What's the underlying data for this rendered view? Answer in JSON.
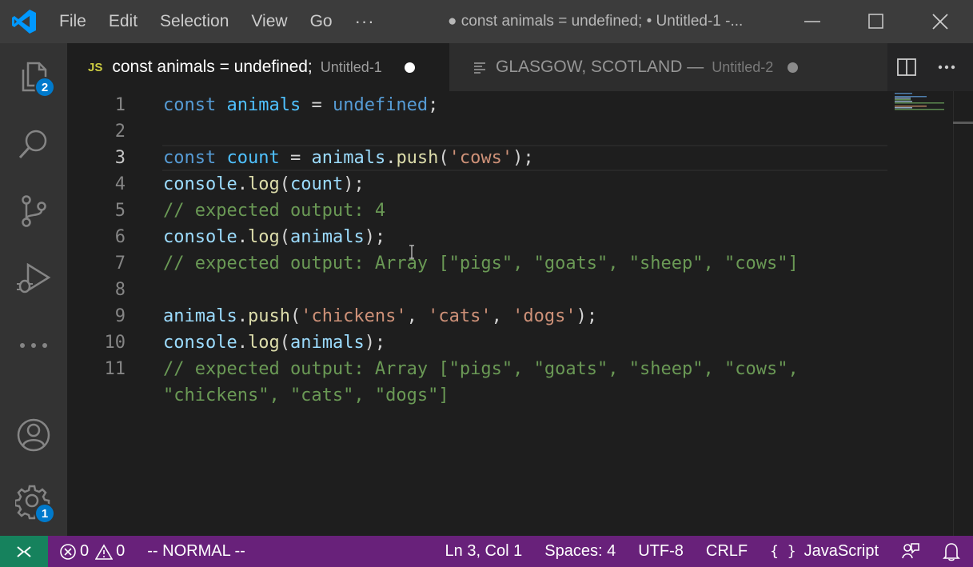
{
  "menu": {
    "file": "File",
    "edit": "Edit",
    "selection": "Selection",
    "view": "View",
    "go": "Go",
    "more": "···"
  },
  "window": {
    "title": "● const animals = undefined; • Untitled-1 -..."
  },
  "activity": {
    "explorer_badge": "2",
    "settings_badge": "1"
  },
  "tabs": [
    {
      "icon": "JS",
      "name": "const animals = undefined;",
      "desc": "Untitled-1",
      "dirty": true
    },
    {
      "icon": "text-lines-icon",
      "name": "GLASGOW, SCOTLAND —",
      "desc": "Untitled-2",
      "dirty": true
    }
  ],
  "editor": {
    "current_line": 3,
    "line_numbers": [
      "1",
      "2",
      "3",
      "4",
      "5",
      "6",
      "7",
      "8",
      "9",
      "10",
      "11"
    ],
    "lines": [
      [
        [
          "kw",
          "const"
        ],
        [
          "p",
          " "
        ],
        [
          "vc",
          "animals"
        ],
        [
          "p",
          " = "
        ],
        [
          "kw",
          "undefined"
        ],
        [
          "p",
          ";"
        ]
      ],
      [],
      [
        [
          "kw",
          "const"
        ],
        [
          "p",
          " "
        ],
        [
          "vc",
          "count"
        ],
        [
          "p",
          " = "
        ],
        [
          "var",
          "animals"
        ],
        [
          "p",
          "."
        ],
        [
          "fn",
          "push"
        ],
        [
          "p",
          "("
        ],
        [
          "str",
          "'cows'"
        ],
        [
          "p",
          ");"
        ]
      ],
      [
        [
          "var",
          "console"
        ],
        [
          "p",
          "."
        ],
        [
          "fn",
          "log"
        ],
        [
          "p",
          "("
        ],
        [
          "var",
          "count"
        ],
        [
          "p",
          ");"
        ]
      ],
      [
        [
          "cm",
          "// expected output: 4"
        ]
      ],
      [
        [
          "var",
          "console"
        ],
        [
          "p",
          "."
        ],
        [
          "fn",
          "log"
        ],
        [
          "p",
          "("
        ],
        [
          "var",
          "animals"
        ],
        [
          "p",
          ");"
        ]
      ],
      [
        [
          "cm",
          "// expected output: Array [\"pigs\", \"goats\", \"sheep\", \"cows\"]"
        ]
      ],
      [],
      [
        [
          "var",
          "animals"
        ],
        [
          "p",
          "."
        ],
        [
          "fn",
          "push"
        ],
        [
          "p",
          "("
        ],
        [
          "str",
          "'chickens'"
        ],
        [
          "p",
          ", "
        ],
        [
          "str",
          "'cats'"
        ],
        [
          "p",
          ", "
        ],
        [
          "str",
          "'dogs'"
        ],
        [
          "p",
          ");"
        ]
      ],
      [
        [
          "var",
          "console"
        ],
        [
          "p",
          "."
        ],
        [
          "fn",
          "log"
        ],
        [
          "p",
          "("
        ],
        [
          "var",
          "animals"
        ],
        [
          "p",
          ");"
        ]
      ],
      [
        [
          "cm",
          "// expected output: Array [\"pigs\", \"goats\", \"sheep\", \"cows\","
        ]
      ],
      [
        [
          "cm",
          "\"chickens\", \"cats\", \"dogs\"]"
        ]
      ]
    ]
  },
  "status": {
    "errors": "0",
    "warnings": "0",
    "mode": "-- NORMAL --",
    "position": "Ln 3, Col 1",
    "spaces": "Spaces: 4",
    "encoding": "UTF-8",
    "eol": "CRLF",
    "language": "JavaScript",
    "language_icon": "{ }"
  },
  "colors": {
    "titlebar": "#3c3c3c",
    "activitybar": "#333333",
    "editor": "#1e1e1e",
    "statusbar": "#68217a",
    "remote": "#16825d",
    "badge": "#007acc"
  }
}
